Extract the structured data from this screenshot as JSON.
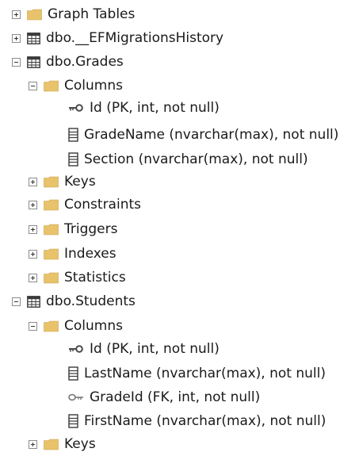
{
  "tree": [
    {
      "label": "Graph Tables",
      "type": "folder",
      "indent": 0,
      "expander": "collapsed"
    },
    {
      "label": "dbo.__EFMigrationsHistory",
      "type": "table",
      "indent": 0,
      "expander": "collapsed"
    },
    {
      "label": "dbo.Grades",
      "type": "table",
      "indent": 0,
      "expander": "expanded"
    },
    {
      "label": "Columns",
      "type": "folder",
      "indent": 1,
      "expander": "expanded"
    },
    {
      "label": "Id (PK, int, not null)",
      "type": "pk",
      "indent": 2,
      "expander": "none"
    },
    {
      "label": "GradeName (nvarchar(max), not null)",
      "type": "column",
      "indent": 2,
      "expander": "none"
    },
    {
      "label": "Section (nvarchar(max), not null)",
      "type": "column",
      "indent": 2,
      "expander": "none"
    },
    {
      "label": "Keys",
      "type": "folder",
      "indent": 1,
      "expander": "collapsed"
    },
    {
      "label": "Constraints",
      "type": "folder",
      "indent": 1,
      "expander": "collapsed"
    },
    {
      "label": "Triggers",
      "type": "folder",
      "indent": 1,
      "expander": "collapsed"
    },
    {
      "label": "Indexes",
      "type": "folder",
      "indent": 1,
      "expander": "collapsed"
    },
    {
      "label": "Statistics",
      "type": "folder",
      "indent": 1,
      "expander": "collapsed"
    },
    {
      "label": "dbo.Students",
      "type": "table",
      "indent": 0,
      "expander": "expanded"
    },
    {
      "label": "Columns",
      "type": "folder",
      "indent": 1,
      "expander": "expanded"
    },
    {
      "label": "Id (PK, int, not null)",
      "type": "pk",
      "indent": 2,
      "expander": "none"
    },
    {
      "label": "LastName (nvarchar(max), not null)",
      "type": "column",
      "indent": 2,
      "expander": "none"
    },
    {
      "label": "GradeId (FK, int, not null)",
      "type": "fk",
      "indent": 2,
      "expander": "none"
    },
    {
      "label": "FirstName (nvarchar(max), not null)",
      "type": "column",
      "indent": 2,
      "expander": "none"
    },
    {
      "label": "Keys",
      "type": "folder",
      "indent": 1,
      "expander": "collapsed"
    }
  ],
  "icons": {
    "folder": "folder-icon",
    "table": "table-icon",
    "pk": "primary-key-icon",
    "fk": "foreign-key-icon",
    "column": "column-icon"
  },
  "colors": {
    "folder": "#E8C36B",
    "table_border": "#3a3a3a",
    "key": "#4a4a4a",
    "text": "#1a1a1a"
  }
}
